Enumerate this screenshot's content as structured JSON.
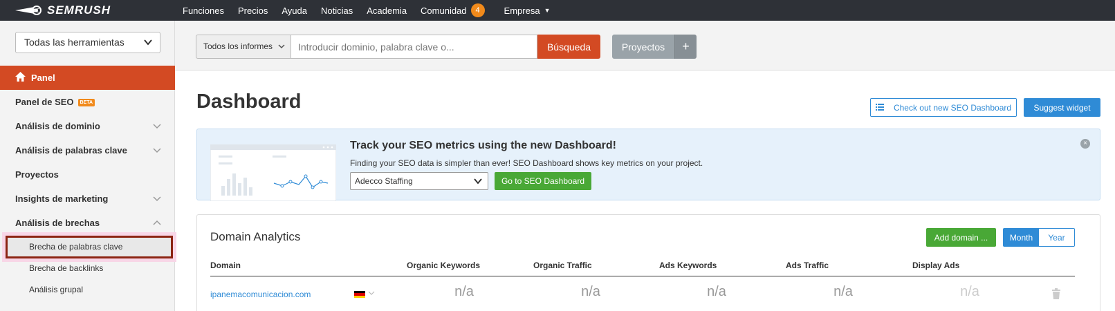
{
  "brand": {
    "name": "SEMRUSH",
    "logo_icon": "fireball-icon"
  },
  "topnav": {
    "links": [
      "Funciones",
      "Precios",
      "Ayuda",
      "Noticias",
      "Academia",
      "Comunidad",
      "Empresa"
    ],
    "community_badge": "4"
  },
  "sidebar": {
    "tool_select": "Todas las herramientas",
    "items": [
      {
        "label": "Panel",
        "active": true,
        "icon": "home-icon"
      },
      {
        "label": "Panel de SEO",
        "badge": "BETA"
      },
      {
        "label": "Análisis de dominio",
        "expand": "chevron-down-icon"
      },
      {
        "label": "Análisis de palabras clave",
        "expand": "chevron-down-icon"
      },
      {
        "label": "Proyectos"
      },
      {
        "label": "Insights de marketing",
        "expand": "chevron-down-icon"
      },
      {
        "label": "Análisis de brechas",
        "expand": "chevron-up-icon"
      }
    ],
    "subitems": [
      "Brecha de palabras clave",
      "Brecha de backlinks",
      "Análisis grupal"
    ]
  },
  "search": {
    "reports_label": "Todos los informes",
    "placeholder": "Introducir dominio, palabra clave o...",
    "search_button": "Búsqueda",
    "projects_button": "Proyectos",
    "plus": "+"
  },
  "dashboard": {
    "title": "Dashboard",
    "checkout_button": "Check out new SEO Dashboard",
    "suggest_button": "Suggest widget"
  },
  "banner": {
    "title": "Track your SEO metrics using the new Dashboard!",
    "description": "Finding your SEO data is simpler than ever! SEO Dashboard shows key metrics on your project.",
    "project_selected": "Adecco Staffing",
    "goto_button": "Go to SEO Dashboard"
  },
  "domain_analytics": {
    "title": "Domain Analytics",
    "add_button": "Add domain ...",
    "toggle": [
      "Month",
      "Year"
    ],
    "toggle_selected": "Month",
    "columns": [
      "Domain",
      "Organic Keywords",
      "Organic Traffic",
      "Ads Keywords",
      "Ads Traffic",
      "Display Ads"
    ],
    "rows": [
      {
        "domain": "ipanemacomunicacion.com",
        "flag": "germany-flag-icon",
        "values": [
          "n/a",
          "n/a",
          "n/a",
          "n/a",
          "n/a"
        ]
      }
    ]
  },
  "colors": {
    "nav_bg": "#2e3137",
    "accent_red": "#d34a23",
    "accent_blue": "#2f8bd6",
    "accent_green": "#49a836",
    "badge_orange": "#f18a1b"
  }
}
